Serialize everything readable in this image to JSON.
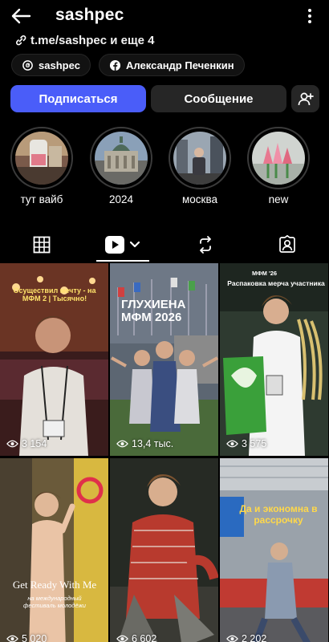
{
  "header": {
    "username": "sashpec",
    "back_icon": "arrow-left-icon",
    "more_icon": "more-vertical-icon"
  },
  "profile": {
    "link_text": "t.me/sashpec и еще 4",
    "chips": [
      {
        "icon": "threads-icon",
        "label": "sashpec"
      },
      {
        "icon": "facebook-icon",
        "label": "Александр Печенкин"
      }
    ]
  },
  "actions": {
    "subscribe_label": "Подписаться",
    "message_label": "Сообщение",
    "add_user_icon": "add-user-icon",
    "subscribe_color": "#4a5df9"
  },
  "highlights": [
    {
      "label": "тут вайб"
    },
    {
      "label": "2024"
    },
    {
      "label": "москва"
    },
    {
      "label": "new"
    }
  ],
  "tabs": [
    {
      "icon": "grid-icon",
      "active": false
    },
    {
      "icon": "reels-icon",
      "active": true
    },
    {
      "icon": "repost-icon",
      "active": false
    },
    {
      "icon": "tagged-icon",
      "active": false
    }
  ],
  "posts": [
    {
      "views": "3 154",
      "caption": "Осуществил мечту - на МФМ 2 | Тысячно!"
    },
    {
      "views": "13,4 тыс.",
      "caption": "ГЛУХИЕНА МФМ 2026"
    },
    {
      "views": "3 575",
      "caption": "Распаковка мерча участника",
      "badge": "МФМ '26"
    },
    {
      "views": "5 020",
      "caption": "Get Ready With Me",
      "subcaption": "на международный фестиваль молодёжи"
    },
    {
      "views": "6 602",
      "caption": ""
    },
    {
      "views": "2 202",
      "caption": "Да и экономна в рассрочку"
    }
  ]
}
